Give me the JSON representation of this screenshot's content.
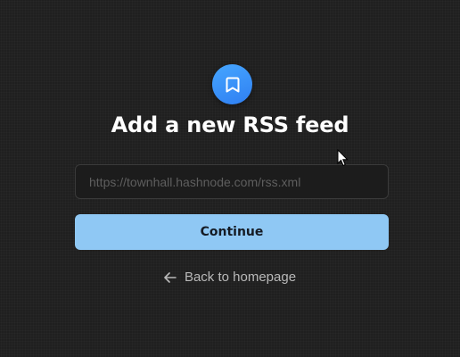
{
  "logo": {
    "icon": "bookmark-icon",
    "colors": [
      "#46a6ff",
      "#2f7ff2"
    ]
  },
  "page": {
    "title": "Add a new RSS feed"
  },
  "form": {
    "url_placeholder": "https://townhall.hashnode.com/rss.xml",
    "url_value": "",
    "continue_label": "Continue"
  },
  "nav": {
    "back_label": "Back to homepage",
    "back_icon": "arrow-left-icon"
  },
  "colors": {
    "background": "#1f1f1f",
    "accent": "#8fc8f4"
  }
}
